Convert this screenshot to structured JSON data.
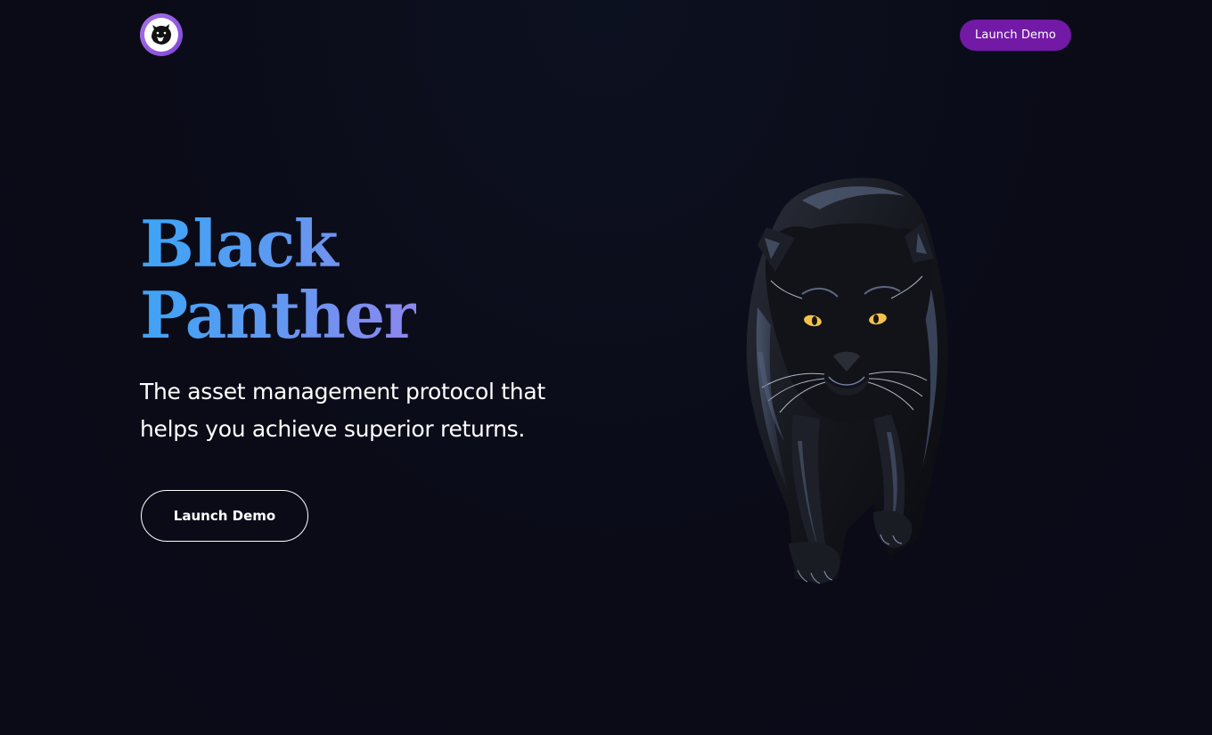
{
  "header": {
    "logo_icon": "panther-logo-icon",
    "launch_label": "Launch Demo"
  },
  "hero": {
    "title_line1": "Black",
    "title_line2": "Panther",
    "subtitle": "The asset management protocol that helps you achieve superior returns.",
    "launch_label": "Launch Demo",
    "image_icon": "panther-illustration"
  },
  "colors": {
    "background": "#0b0b18",
    "nav_button": "#7219a6",
    "title_gradient_start": "#3aa5f6",
    "title_gradient_end": "#8f86ee",
    "logo_ring": "#8a52dd",
    "panther_eye": "#f2c24a"
  }
}
